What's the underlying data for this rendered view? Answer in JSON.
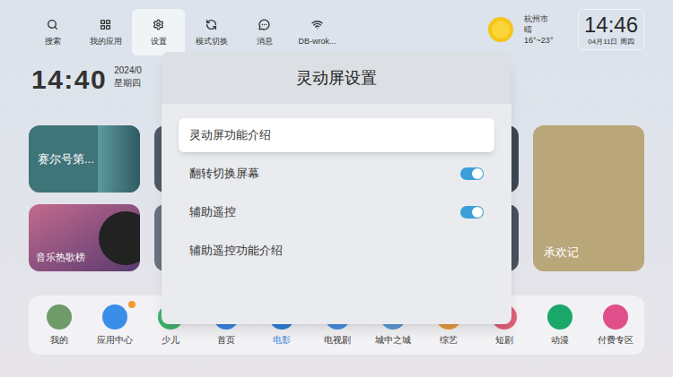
{
  "top_bar": {
    "items": [
      {
        "label": "搜索",
        "selected": false
      },
      {
        "label": "我的应用",
        "selected": false
      },
      {
        "label": "设置",
        "selected": true
      },
      {
        "label": "模式切换",
        "selected": false
      },
      {
        "label": "消息",
        "selected": false
      },
      {
        "label": "DB-wrok...",
        "selected": false
      }
    ]
  },
  "weather": {
    "city": "杭州市",
    "condition": "晴",
    "range": "16°~23°"
  },
  "clock": {
    "time": "14:46",
    "date": "04月11日 周四"
  },
  "home_clock": {
    "time": "14:40",
    "date": "2024/0",
    "weekday": "星期四"
  },
  "cards": [
    {
      "title": "赛尔号第...",
      "color": "#3f7478"
    },
    {
      "title": "音乐热歌榜",
      "color": "#a8507a"
    },
    {
      "title": "承欢记",
      "color": "#b9a679"
    }
  ],
  "bottom_nav": [
    {
      "label": "我的",
      "selected": false,
      "badge": false,
      "color": "#6f9a6a"
    },
    {
      "label": "应用中心",
      "selected": false,
      "badge": true,
      "color": "#3b8ee8"
    },
    {
      "label": "少儿",
      "selected": false,
      "badge": false,
      "color": "#3fb36a"
    },
    {
      "label": "首页",
      "selected": false,
      "badge": false,
      "color": "#3a86e0"
    },
    {
      "label": "电影",
      "selected": true,
      "badge": false,
      "color": "#2f7fd8"
    },
    {
      "label": "电视剧",
      "selected": false,
      "badge": false,
      "color": "#4a8fe0"
    },
    {
      "label": "城中之城",
      "selected": false,
      "badge": false,
      "color": "#5b9ad8"
    },
    {
      "label": "综艺",
      "selected": false,
      "badge": false,
      "color": "#e89a3c"
    },
    {
      "label": "短剧",
      "selected": false,
      "badge": false,
      "color": "#e0607a"
    },
    {
      "label": "动漫",
      "selected": false,
      "badge": false,
      "color": "#1aa86a"
    },
    {
      "label": "付费专区",
      "selected": false,
      "badge": false,
      "color": "#e04f8a"
    }
  ],
  "dialog": {
    "title": "灵动屏设置",
    "rows": [
      {
        "label": "灵动屏功能介绍",
        "kind": "link",
        "selected": true
      },
      {
        "label": "翻转切换屏幕",
        "kind": "toggle",
        "on": true,
        "selected": false
      },
      {
        "label": "辅助遥控",
        "kind": "toggle",
        "on": true,
        "selected": false
      },
      {
        "label": "辅助遥控功能介绍",
        "kind": "link",
        "selected": false
      }
    ]
  }
}
